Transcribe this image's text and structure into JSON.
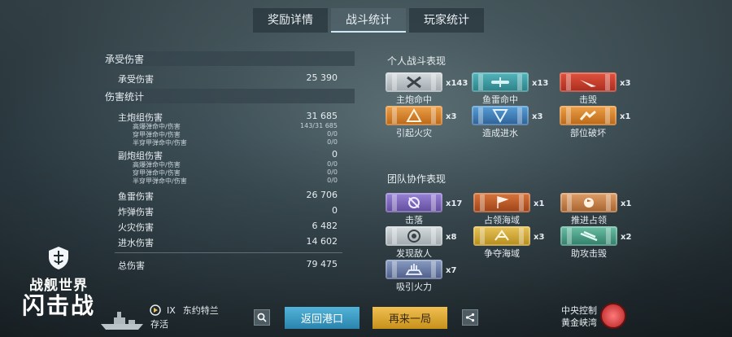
{
  "tabs": [
    {
      "label": "奖励详情",
      "active": false
    },
    {
      "label": "战斗统计",
      "active": true
    },
    {
      "label": "玩家统计",
      "active": false
    }
  ],
  "damage_received": {
    "header": "承受伤害",
    "row": {
      "label": "承受伤害",
      "value": "25 390"
    }
  },
  "damage_stats": {
    "header": "伤害统计",
    "main_battery": {
      "label": "主炮组伤害",
      "value": "31 685"
    },
    "main_sub": [
      {
        "label": "高爆弹命中/伤害",
        "value": "143/31 685"
      },
      {
        "label": "穿甲弹命中/伤害",
        "value": "0/0"
      },
      {
        "label": "半穿甲弹命中/伤害",
        "value": "0/0"
      }
    ],
    "secondary": {
      "label": "副炮组伤害",
      "value": "0"
    },
    "secondary_sub": [
      {
        "label": "高爆弹命中/伤害",
        "value": "0/0"
      },
      {
        "label": "穿甲弹命中/伤害",
        "value": "0/0"
      },
      {
        "label": "半穿甲弹命中/伤害",
        "value": "0/0"
      }
    ],
    "torpedo": {
      "label": "鱼雷伤害",
      "value": "26 706"
    },
    "bomb": {
      "label": "炸弹伤害",
      "value": "0"
    },
    "fire": {
      "label": "火灾伤害",
      "value": "6 482"
    },
    "flood": {
      "label": "进水伤害",
      "value": "14 602"
    },
    "total": {
      "label": "总伤害",
      "value": "79 475"
    }
  },
  "personal": {
    "title": "个人战斗表现",
    "medals": [
      {
        "label": "主炮命中",
        "count": "x143",
        "color": "#b8c0c5",
        "icon": "crossed-guns-icon"
      },
      {
        "label": "鱼雷命中",
        "count": "x13",
        "color": "#3f9aa2",
        "icon": "torpedo-icon"
      },
      {
        "label": "击毁",
        "count": "x3",
        "color": "#c8402c",
        "icon": "sinking-ship-icon"
      },
      {
        "label": "引起火灾",
        "count": "x3",
        "color": "#d9842e",
        "icon": "fire-icon"
      },
      {
        "label": "造成进水",
        "count": "x3",
        "color": "#3f7fb8",
        "icon": "water-icon"
      },
      {
        "label": "部位破坏",
        "count": "x1",
        "color": "#d9842e",
        "icon": "broken-part-icon"
      }
    ]
  },
  "team": {
    "title": "团队协作表现",
    "medals": [
      {
        "label": "击落",
        "count": "x17",
        "color": "#7c66b8",
        "icon": "plane-down-icon"
      },
      {
        "label": "占领海域",
        "count": "x1",
        "color": "#c15a2a",
        "icon": "flag-icon"
      },
      {
        "label": "推进占领",
        "count": "x1",
        "color": "#c2803f",
        "icon": "capture-icon"
      },
      {
        "label": "发现敌人",
        "count": "x8",
        "color": "#b8c0c5",
        "icon": "spotting-icon"
      },
      {
        "label": "争夺海域",
        "count": "x3",
        "color": "#cfa73a",
        "icon": "contest-icon"
      },
      {
        "label": "助攻击毁",
        "count": "x2",
        "color": "#4fa088",
        "icon": "assist-icon"
      },
      {
        "label": "吸引火力",
        "count": "x7",
        "color": "#6a7ca8",
        "icon": "tank-damage-icon"
      }
    ]
  },
  "logo": {
    "line1": "战舰世界",
    "line2": "闪击战"
  },
  "ship": {
    "tier": "IX",
    "name": "东约特兰",
    "status": "存活"
  },
  "buttons": {
    "return_port": "返回港口",
    "play_again": "再来一局"
  },
  "map": {
    "mode": "中央控制",
    "name": "黄金峡湾"
  }
}
